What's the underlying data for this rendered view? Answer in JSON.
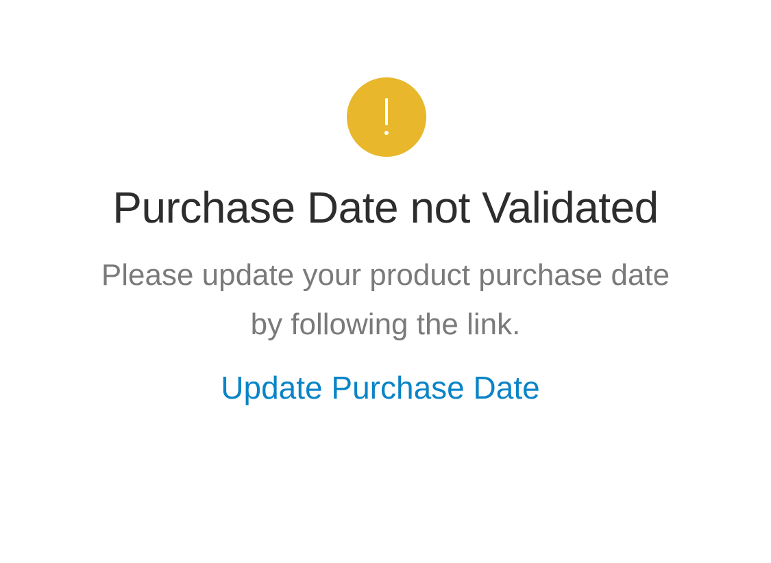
{
  "alert": {
    "icon": "exclamation-icon",
    "icon_color": "#e8b72c",
    "title": "Purchase Date not Validated",
    "message_lines": [
      "Please update your product purchase date",
      "by following the link."
    ]
  },
  "action": {
    "link_label": "Update Purchase Date",
    "link_color": "#0a84c7"
  }
}
